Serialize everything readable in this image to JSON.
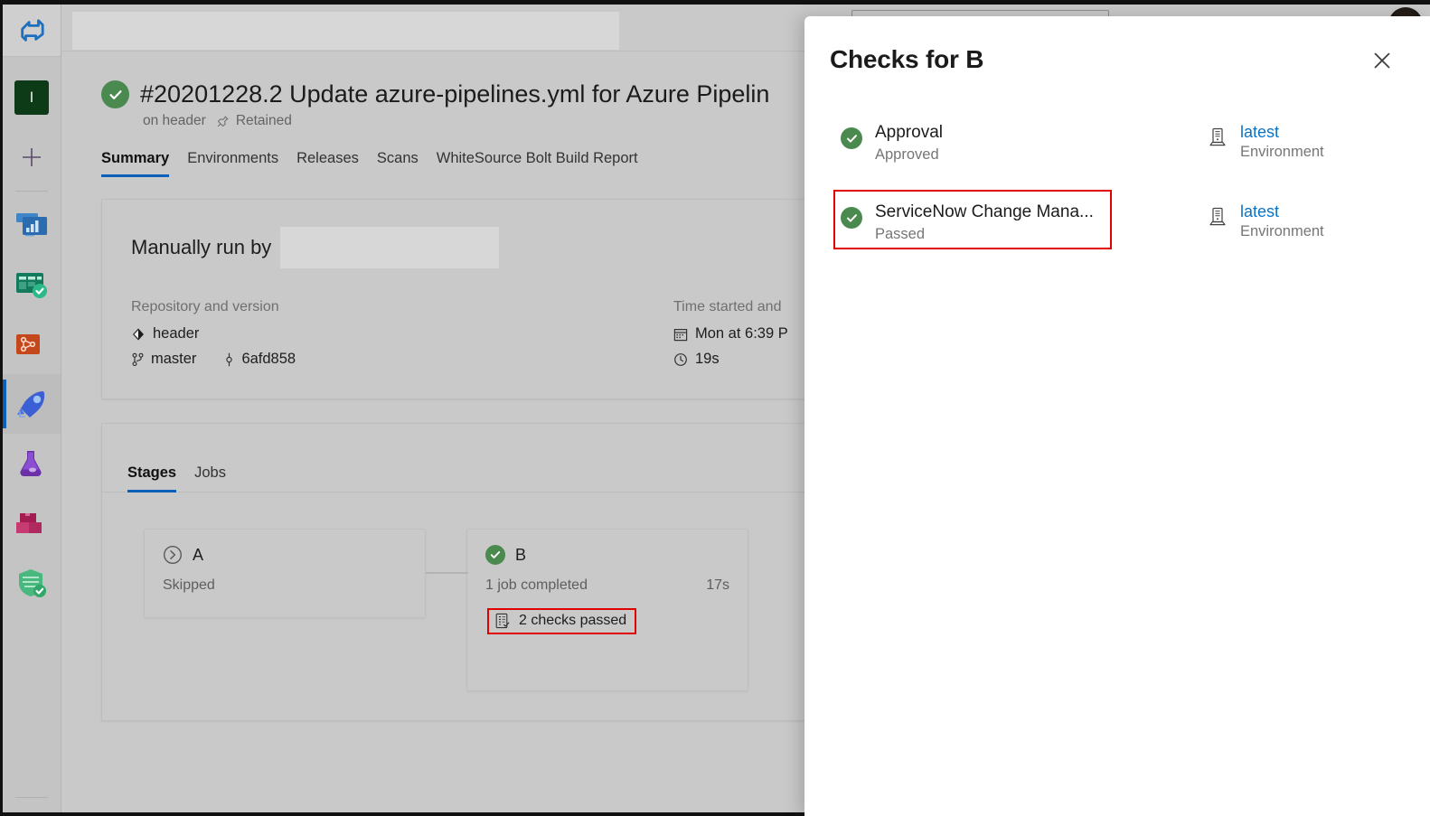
{
  "window": {
    "chrome_color": "#111111",
    "page_bg": "#c9c9c9"
  },
  "rail": {
    "logo_name": "azure-devops-logo",
    "items": [
      {
        "name": "project-avatar",
        "label": "I",
        "icon": "project-initial-icon",
        "selected": false
      },
      {
        "name": "create-new",
        "label": "",
        "icon": "plus-icon",
        "selected": false
      },
      {
        "name": "overview",
        "label": "Overview",
        "icon": "overview-icon",
        "selected": false
      },
      {
        "name": "boards",
        "label": "Boards",
        "icon": "boards-icon",
        "selected": false
      },
      {
        "name": "repos",
        "label": "Repos",
        "icon": "repos-icon",
        "selected": false
      },
      {
        "name": "pipelines",
        "label": "Pipelines",
        "icon": "pipelines-rocket-icon",
        "selected": true
      },
      {
        "name": "test-plans",
        "label": "Test Plans",
        "icon": "test-plans-flask-icon",
        "selected": false
      },
      {
        "name": "artifacts",
        "label": "Artifacts",
        "icon": "artifacts-icon",
        "selected": false
      },
      {
        "name": "security",
        "label": "Security",
        "icon": "security-shield-icon",
        "selected": false
      }
    ]
  },
  "topbar": {
    "breadcrumb_redacted": true,
    "search_placeholder": "",
    "search_value": "",
    "avatar_name": "user-avatar"
  },
  "run": {
    "status_icon": "success-check-icon",
    "title": "#20201228.2 Update azure-pipelines.yml for Azure Pipelin",
    "branch_prefix": "on header",
    "retained_icon": "pin-icon",
    "retained_label": "Retained"
  },
  "tabs": [
    {
      "label": "Summary",
      "active": true
    },
    {
      "label": "Environments",
      "active": false
    },
    {
      "label": "Releases",
      "active": false
    },
    {
      "label": "Scans",
      "active": false
    },
    {
      "label": "WhiteSource Bolt Build Report",
      "active": false
    }
  ],
  "summary": {
    "manual_run_label": "Manually run by",
    "user_redacted": true,
    "left": {
      "heading": "Repository and version",
      "repo_icon": "git-repo-icon",
      "repo_name": "header",
      "branch_icon": "git-branch-icon",
      "branch_name": "master",
      "commit_icon": "git-commit-icon",
      "commit_sha": "6afd858"
    },
    "right": {
      "heading": "Time started and",
      "calendar_icon": "calendar-icon",
      "started": "Mon at 6:39 P",
      "clock_icon": "clock-icon",
      "duration": "19s"
    }
  },
  "stages_panel": {
    "tabs": [
      {
        "label": "Stages",
        "active": true
      },
      {
        "label": "Jobs",
        "active": false
      }
    ],
    "stages": [
      {
        "name": "A",
        "status_icon": "skipped-chevron-icon",
        "status_text": "Skipped",
        "duration": "",
        "checks": null
      },
      {
        "name": "B",
        "status_icon": "success-check-icon",
        "status_text": "1 job completed",
        "duration": "17s",
        "checks": {
          "icon": "checklist-icon",
          "label": "2 checks passed",
          "highlight_color": "#e00000"
        }
      }
    ]
  },
  "checks_panel": {
    "title": "Checks for B",
    "close_icon": "close-icon",
    "rows": [
      {
        "status_icon": "success-check-icon",
        "name": "Approval",
        "status": "Approved",
        "env_icon": "environment-server-icon",
        "env_name": "latest",
        "env_sub": "Environment",
        "highlighted": false
      },
      {
        "status_icon": "success-check-icon",
        "name": "ServiceNow Change Mana...",
        "status": "Passed",
        "env_icon": "environment-server-icon",
        "env_name": "latest",
        "env_sub": "Environment",
        "highlighted": true
      }
    ]
  },
  "colors": {
    "success_green": "#4a8a4f",
    "accent_blue": "#0a5fb8",
    "link_blue": "#0a72c4",
    "highlight_red": "#e00000"
  }
}
